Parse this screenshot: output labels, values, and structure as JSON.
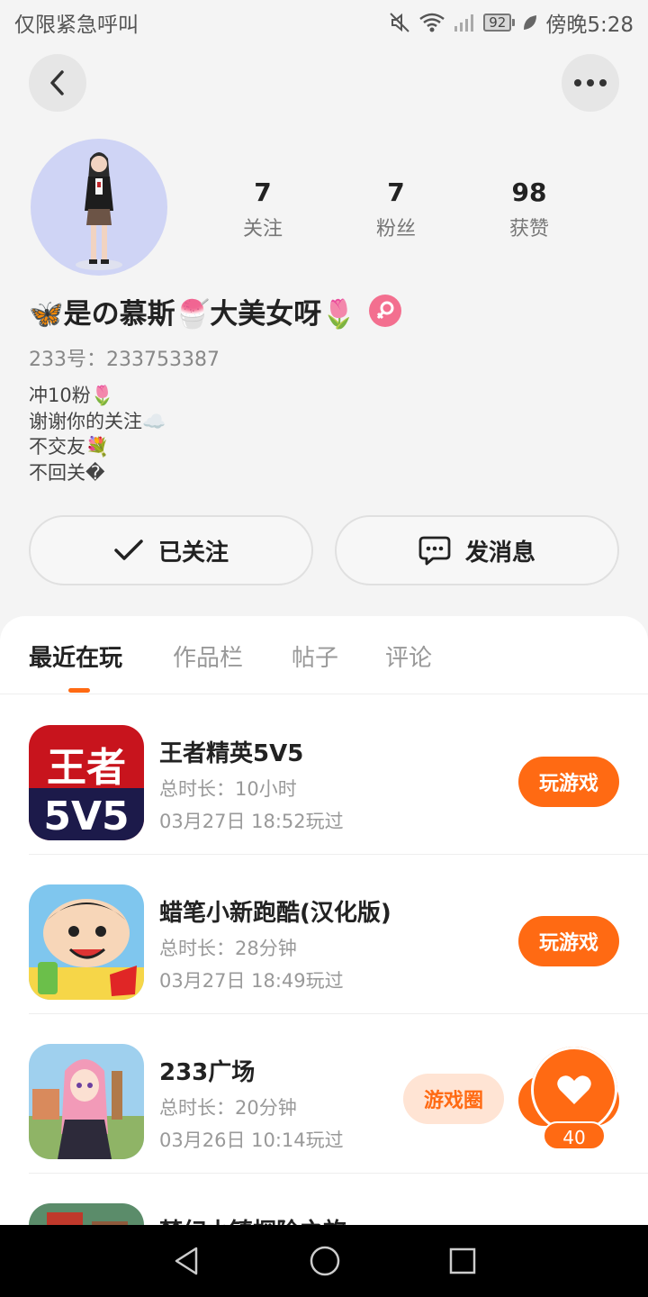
{
  "status_bar": {
    "carrier": "仅限紧急呼叫",
    "battery": "92",
    "time": "傍晚5:28"
  },
  "profile": {
    "stats": [
      {
        "value": "7",
        "label": "关注"
      },
      {
        "value": "7",
        "label": "粉丝"
      },
      {
        "value": "98",
        "label": "获赞"
      }
    ],
    "nickname": "🦋是の慕斯🍧大美女呀🌷",
    "user_id": "233号：233753387",
    "bio": [
      "冲10粉🌷",
      "谢谢你的关注☁️",
      "不交友💐",
      "不回关�"
    ]
  },
  "actions": {
    "follow_label": "已关注",
    "message_label": "发消息"
  },
  "tabs": [
    {
      "label": "最近在玩",
      "active": true
    },
    {
      "label": "作品栏",
      "active": false
    },
    {
      "label": "帖子",
      "active": false
    },
    {
      "label": "评论",
      "active": false
    }
  ],
  "games": [
    {
      "title": "王者精英5V5",
      "duration": "总时长：10小时",
      "last_played": "03月27日 18:52玩过",
      "button": "玩游戏",
      "icon": "wangzhe-5v5-icon"
    },
    {
      "title": "蜡笔小新跑酷(汉化版)",
      "duration": "总时长：28分钟",
      "last_played": "03月27日 18:49玩过",
      "button": "玩游戏",
      "icon": "crayon-shinchan-icon"
    },
    {
      "title": "233广场",
      "duration": "总时长：20分钟",
      "last_played": "03月26日 10:14玩过",
      "circle_button": "游戏圈",
      "button": "玩游戏",
      "icon": "233-plaza-icon"
    },
    {
      "title": "梦幻小镇探险之旅",
      "icon": "dream-town-icon"
    }
  ],
  "like": {
    "count": "40"
  },
  "colors": {
    "accent": "#ff6a13",
    "accent_light": "#ffe4d4",
    "female": "#f36f8f",
    "avatar_bg": "#cfd4f5"
  }
}
